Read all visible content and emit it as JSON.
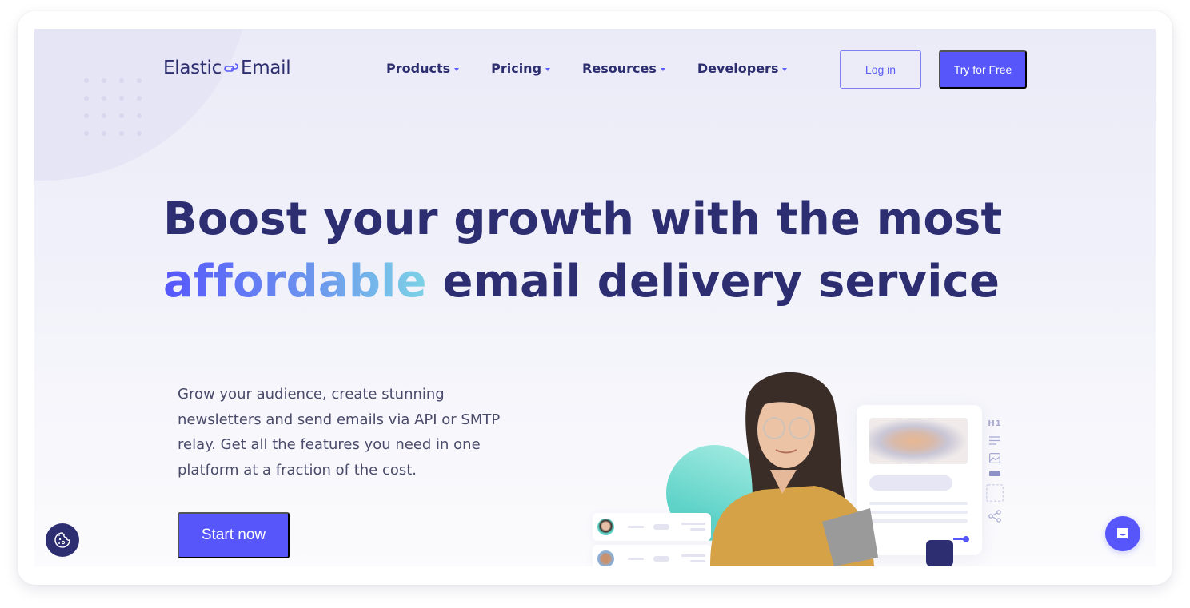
{
  "brand": {
    "logo_left": "Elastic",
    "logo_right": "Email",
    "logo_icon": "link-icon",
    "colors": {
      "primary": "#5656fb",
      "navy": "#2d2e72",
      "accent_gradient_start": "#5656fb",
      "accent_gradient_end": "#7dd3e6",
      "teal": "#5fd3c8"
    }
  },
  "nav": {
    "items": [
      {
        "label": "Products",
        "icon": "caret-down-icon"
      },
      {
        "label": "Pricing",
        "icon": "caret-down-icon"
      },
      {
        "label": "Resources",
        "icon": "caret-down-icon"
      },
      {
        "label": "Developers",
        "icon": "caret-down-icon"
      }
    ],
    "login_label": "Log in",
    "try_label": "Try for Free"
  },
  "hero": {
    "headline_line1": "Boost your growth with the most",
    "headline_accent": "affordable",
    "headline_line2_rest": " email delivery service",
    "subtext": "Grow your audience, create stunning newsletters and send emails via API or SMTP relay. Get all the features you need in one platform at a fraction of the cost.",
    "cta_label": "Start now"
  },
  "illustration": {
    "toolbar_heading_label": "H1",
    "toolbar_icons": [
      "heading-icon",
      "text-lines-icon",
      "image-icon",
      "button-block-icon",
      "placeholder-block-icon",
      "share-icon"
    ]
  },
  "widgets": {
    "cookie_icon": "cookie-icon",
    "chat_icon": "chat-icon"
  }
}
